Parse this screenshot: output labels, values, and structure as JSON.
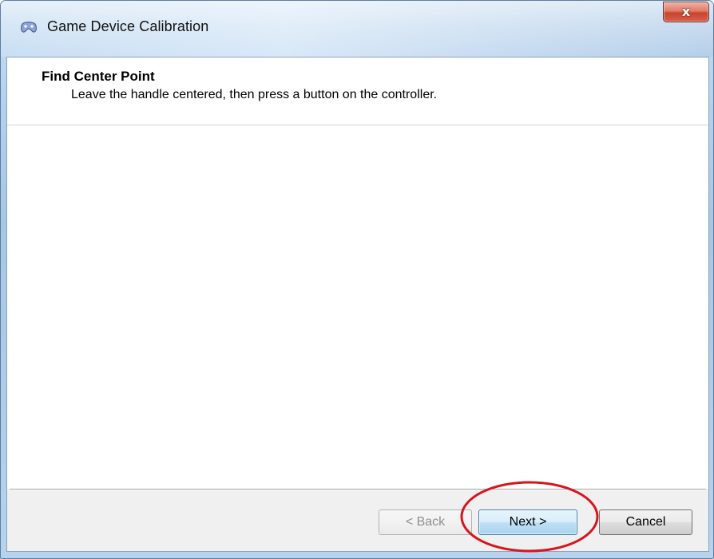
{
  "window": {
    "title": "Game Device Calibration",
    "title_icon": "gamepad-icon",
    "close_label": "x"
  },
  "header": {
    "title": "Find Center Point",
    "subtitle": "Leave the handle centered, then press a button on the controller."
  },
  "buttons": {
    "back_label": "< Back",
    "back_enabled": false,
    "next_label": "Next >",
    "cancel_label": "Cancel"
  },
  "annotation": {
    "shape": "ellipse",
    "color": "#d8141d",
    "target": "next-button"
  },
  "colors": {
    "frame": "#b4d1ee",
    "close_button": "#c7452e",
    "default_button_border": "#3c7fb1"
  }
}
